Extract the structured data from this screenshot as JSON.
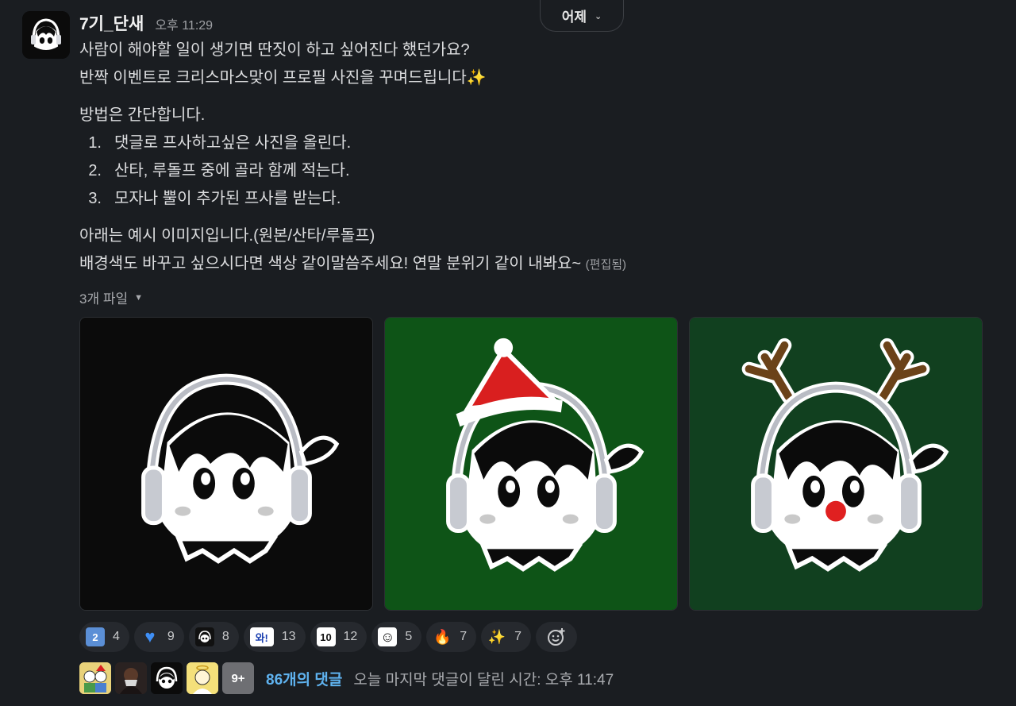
{
  "date_divider": {
    "label": "어제"
  },
  "message": {
    "sender": "7기_단새",
    "time": "오후 11:29",
    "intro_lines": [
      "사람이 해야할 일이 생기면 딴짓이 하고 싶어진다 했던가요?",
      "반짝 이벤트로 크리스마스맞이 프로필 사진을 꾸며드립니다"
    ],
    "sparkle_emoji": "✨",
    "method_heading": "방법은 간단합니다.",
    "steps": [
      {
        "num": "1.",
        "text": "댓글로 프사하고싶은 사진을 올린다."
      },
      {
        "num": "2.",
        "text": "산타, 루돌프 중에 골라 함께 적는다."
      },
      {
        "num": "3.",
        "text": "모자나 뿔이 추가된 프사를 받는다."
      }
    ],
    "outro_lines": [
      "아래는 예시 이미지입니다.(원본/산타/루돌프)",
      "배경색도 바꾸고 싶으시다면 색상 같이말씀주세요! 연말 분위기 같이 내봐요~"
    ],
    "edited_label": "(편집됨)"
  },
  "files": {
    "label": "3개 파일",
    "items": [
      {
        "name": "original",
        "bg": "#0b0b0b"
      },
      {
        "name": "santa",
        "bg": "#0e5417"
      },
      {
        "name": "rudolph",
        "bg": "#11401f"
      }
    ]
  },
  "reactions": [
    {
      "icon": "keycap-two-icon",
      "glyph": "2",
      "bg": "#5b8fd6",
      "fg": "#ffffff",
      "count": "4"
    },
    {
      "icon": "blue-heart-icon",
      "glyph": "♥",
      "bg": "transparent",
      "fg": "#3f8ff5",
      "count": "9"
    },
    {
      "icon": "custom-avatar-emoji-icon",
      "glyph": "●",
      "bg": "#111111",
      "fg": "#ffffff",
      "count": "8"
    },
    {
      "icon": "wa-text-emoji-icon",
      "glyph": "와!",
      "bg": "#ffffff",
      "fg": "#1a3fb0",
      "count": "13"
    },
    {
      "icon": "ten-text-emoji-icon",
      "glyph": "10",
      "bg": "#ffffff",
      "fg": "#111111",
      "count": "12"
    },
    {
      "icon": "person-sketch-emoji-icon",
      "glyph": "☺",
      "bg": "#ffffff",
      "fg": "#111111",
      "count": "5"
    },
    {
      "icon": "fire-icon",
      "glyph": "🔥",
      "bg": "transparent",
      "fg": "#ff7a1a",
      "count": "7"
    },
    {
      "icon": "sparkles-icon",
      "glyph": "✨",
      "bg": "transparent",
      "fg": "#f6d54a",
      "count": "7"
    }
  ],
  "thread": {
    "avatars": [
      {
        "icon": "group-cartoon-avatar",
        "bg": "#e9d27a"
      },
      {
        "icon": "dark-avatar",
        "bg": "#2a2221"
      },
      {
        "icon": "headphone-avatar",
        "bg": "#0b0b0b"
      },
      {
        "icon": "angel-avatar",
        "bg": "#f4e07a"
      }
    ],
    "more_label": "9+",
    "replies_label": "86개의 댓글",
    "last_reply_label": "오늘 마지막 댓글이 달린 시간: 오후 11:47"
  }
}
